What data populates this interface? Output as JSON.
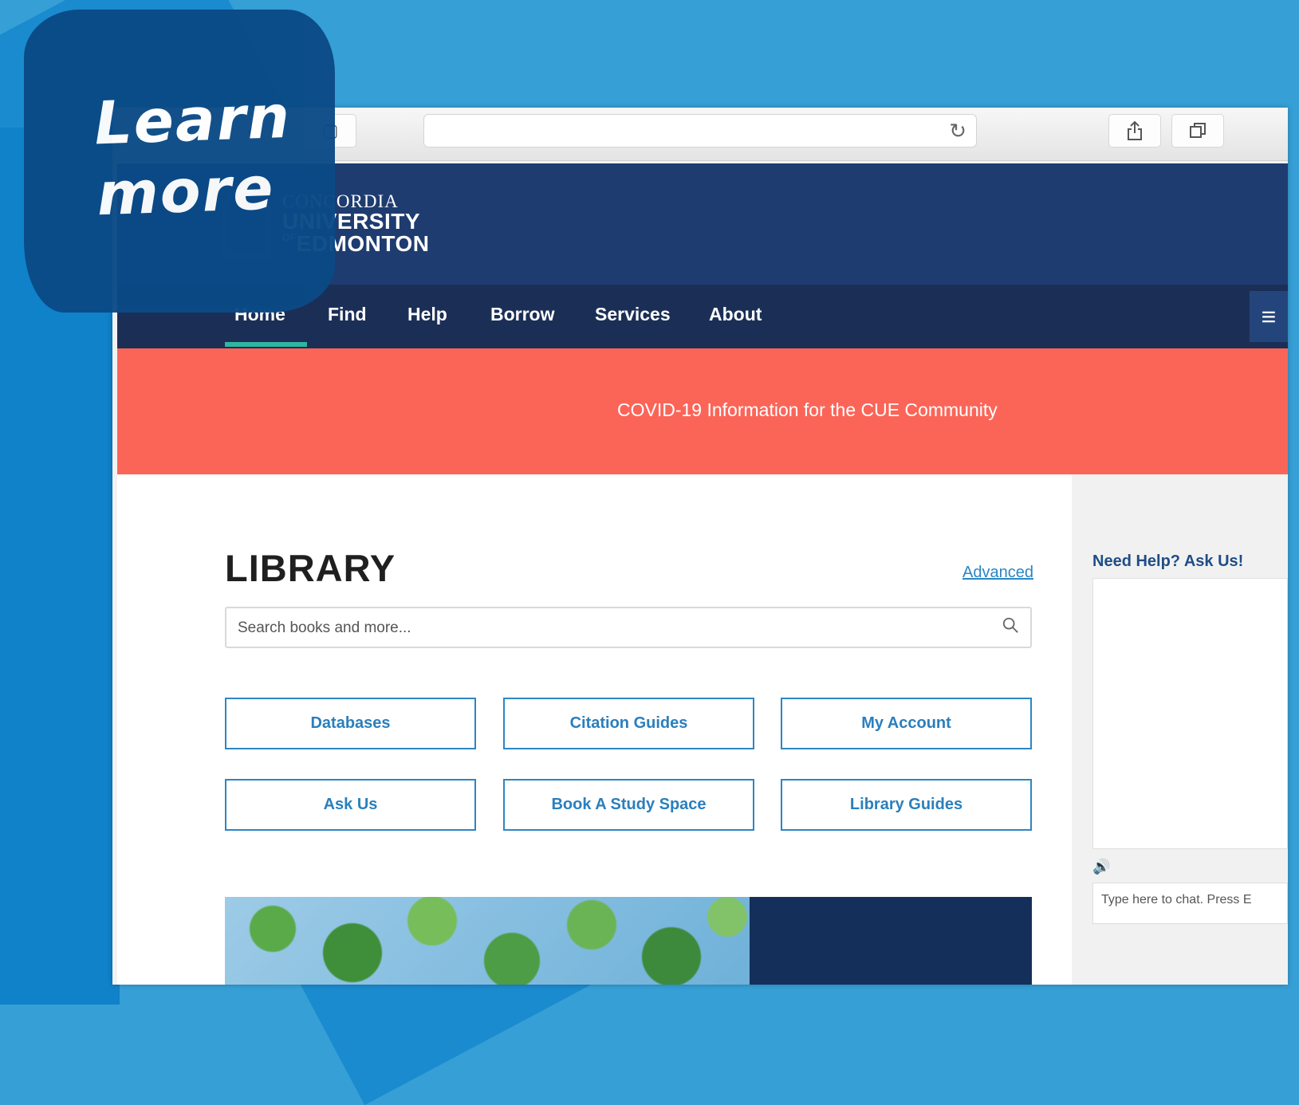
{
  "sticker": {
    "line1": "Learn",
    "line2": "more"
  },
  "browser": {
    "toolbar": {
      "share_icon": "share-icon",
      "tabs_icon": "tabs-icon",
      "reload_icon": "reload-icon"
    }
  },
  "site": {
    "logo": {
      "line1": "CONCORDIA",
      "line2": "UNIVERSITY",
      "line3_prefix": "OF",
      "line3": "EDMONTON"
    },
    "nav": [
      "Home",
      "Find",
      "Help",
      "Borrow",
      "Services",
      "About"
    ],
    "alert": "COVID-19 Information for the CUE Community",
    "library": {
      "title": "LIBRARY",
      "advanced": "Advanced",
      "search_placeholder": "Search books and more...",
      "buttons": [
        "Databases",
        "Citation Guides",
        "My Account",
        "Ask Us",
        "Book A Study Space",
        "Library Guides"
      ]
    },
    "sidebar": {
      "help_title": "Need Help? Ask Us!",
      "chat_placeholder": "Type here to chat. Press E"
    }
  },
  "colors": {
    "header": "#1e3c70",
    "nav": "#1b2f56",
    "alert": "#fb6558",
    "accent": "#2d86c4",
    "underline": "#2fb6a0"
  }
}
